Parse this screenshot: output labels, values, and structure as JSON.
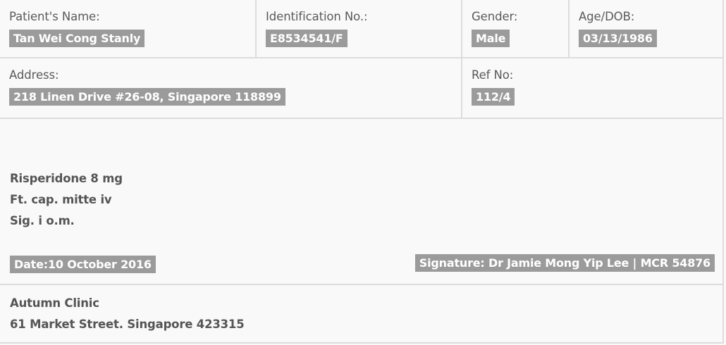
{
  "patient": {
    "name_label": "Patient's Name:",
    "name_value": "Tan Wei Cong Stanly",
    "id_label": "Identification No.:",
    "id_value": "E8534541/F",
    "gender_label": "Gender:",
    "gender_value": "Male",
    "age_label": "Age/DOB:",
    "age_value": "03/13/1986",
    "address_label": "Address:",
    "address_value": "218 Linen Drive #26-08, Singapore 118899",
    "ref_label": "Ref No:",
    "ref_value": "112/4"
  },
  "prescription": {
    "lines": [
      "Risperidone 8 mg",
      "Ft. cap. mitte iv",
      "Sig. i o.m."
    ],
    "date": "Date:10 October 2016",
    "signature": "Signature: Dr Jamie Mong Yip Lee | MCR 54876"
  },
  "clinic": {
    "name": "Autumn Clinic",
    "address": "61 Market Street. Singapore 423315"
  },
  "colors": {
    "tag_background": "#9b9b9b",
    "border": "#dcdcdc",
    "page_background": "#f9f9f9"
  }
}
